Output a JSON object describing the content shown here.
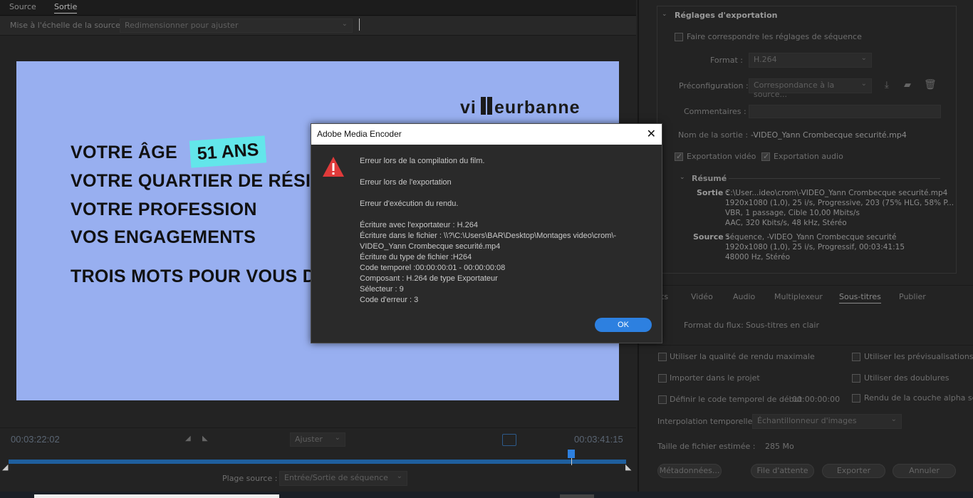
{
  "tabs": {
    "source": "Source",
    "output": "Sortie"
  },
  "scale": {
    "label": "Mise à l'échelle de la source :",
    "value": "Redimensionner pour ajuster"
  },
  "preview": {
    "logo": "villeurbanne",
    "line1": "VOTRE ÂGE",
    "badge": "51 ANS",
    "line2": "VOTRE QUARTIER DE RÉSIDE",
    "line3": "VOTRE PROFESSION",
    "line4": "VOS ENGAGEMENTS",
    "line5": "TROIS MOTS POUR VOUS DE"
  },
  "timeline": {
    "current": "00:03:22:02",
    "total": "00:03:41:15",
    "fit": "Ajuster",
    "range_label": "Plage source :",
    "range_value": "Entrée/Sortie de séquence",
    "playhead_fraction": 0.91
  },
  "dialog": {
    "title": "Adobe Media Encoder",
    "lines": [
      "Erreur lors de la compilation du film.",
      "Erreur lors de l'exportation",
      "Erreur d'exécution du rendu.",
      "Écriture  avec  l'exportateur : H.264",
      "Écriture dans le fichier : \\\\?\\C:\\Users\\BAR\\Desktop\\Montages video\\crom\\-",
      "VIDEO_Yann Crombecque securité.mp4",
      "Écriture du type de fichier :H264",
      "Code temporel :00:00:00:01 - 00:00:00:08",
      "Composant  : H.264 de type Exportateur",
      "Sélecteur : 9",
      "Code  d'erreur : 3"
    ],
    "ok": "OK",
    "close": "✕"
  },
  "export": {
    "title": "Réglages d'exportation",
    "match_seq": "Faire correspondre les réglages de séquence",
    "format_label": "Format :",
    "format_value": "H.264",
    "preset_label": "Préconfiguration :",
    "preset_value": "Correspondance à la source...",
    "comments_label": "Commentaires :",
    "output_name_label": "Nom de la sortie :",
    "output_name_value": "-VIDEO_Yann Crombecque securité.mp4",
    "export_video": "Exportation vidéo",
    "export_audio": "Exportation audio",
    "summary_title": "Résumé",
    "output_label": "Sortie :",
    "output_lines": [
      "C:\\User...ideo\\crom\\-VIDEO_Yann Crombecque securité.mp4",
      "1920x1080 (1,0), 25  i/s, Progressive, 203 (75% HLG, 58% P...",
      "VBR, 1 passage, Cible 10,00  Mbits/s",
      "AAC, 320  Kbits/s, 48  kHz, Stéréo"
    ],
    "source_label": "Source :",
    "source_lines": [
      "Séquence, -VIDEO_Yann Crombecque securité",
      "1920x1080 (1,0), 25  i/s, Progressif, 00:03:41:15",
      "48000 Hz, Stéréo"
    ]
  },
  "tabs2": [
    "ts",
    "Vidéo",
    "Audio",
    "Multiplexeur",
    "Sous-titres",
    "Publier"
  ],
  "stream_format": {
    "label": "Format du flux:",
    "value": "Sous-titres en clair"
  },
  "options": {
    "max_quality": "Utiliser la qualité de rendu maximale",
    "use_previews": "Utiliser les prévisualisations",
    "import_project": "Importer dans le projet",
    "use_proxies": "Utiliser des doublures",
    "start_tc": "Définir le code temporel de début",
    "start_tc_value": "00:00:00:00",
    "alpha": "Rendu de la couche alpha seule"
  },
  "interp": {
    "label": "Interpolation temporelle :",
    "value": "Échantillonneur d'images"
  },
  "filesize": {
    "label": "Taille de fichier estimée :",
    "value": "285 Mo"
  },
  "buttons": {
    "metadata": "Métadonnées...",
    "queue": "File d'attente",
    "export": "Exporter",
    "cancel": "Annuler"
  }
}
